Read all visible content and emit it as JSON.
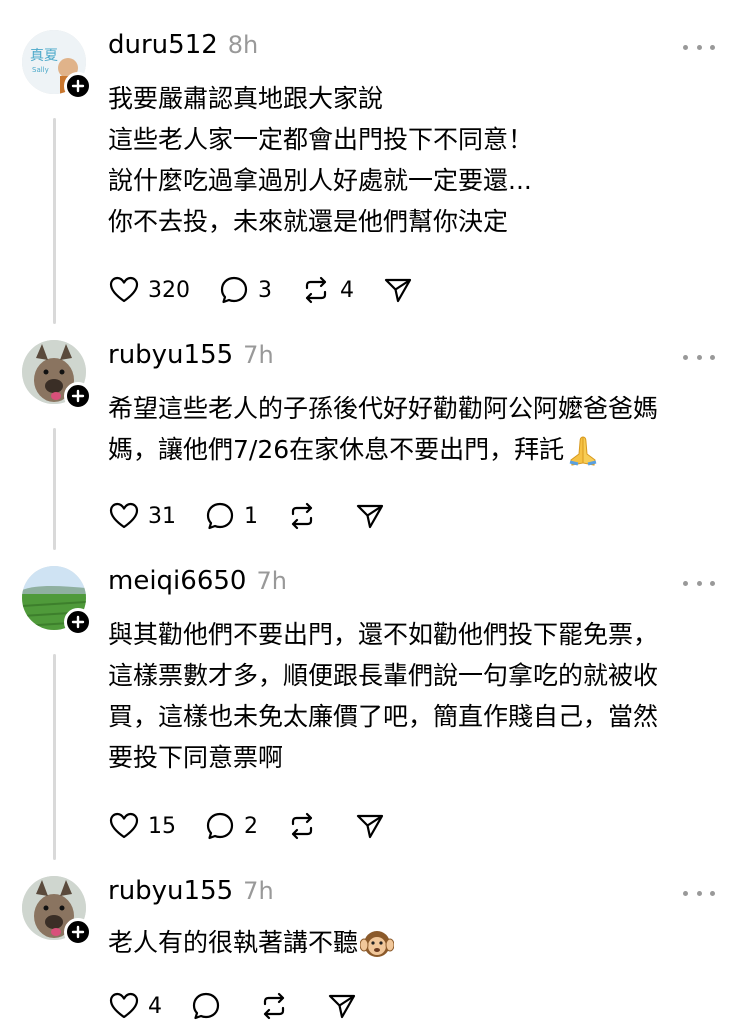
{
  "posts": [
    {
      "username": "duru512",
      "time": "8h",
      "avatar_text": "真夏",
      "avatar_subtext": "Sally",
      "lines": [
        "我要嚴肅認真地跟大家說",
        "這些老人家一定都會出門投下不同意！",
        "說什麼吃過拿過別人好處就一定要還...",
        "你不去投，未來就還是他們幫你決定"
      ],
      "likes": "320",
      "replies": "3",
      "reposts": "4"
    },
    {
      "username": "rubyu155",
      "time": "7h",
      "lines": [
        "希望這些老人的子孫後代好好勸勸阿公阿嬤爸爸媽",
        "媽，讓他們7/26在家休息不要出門，拜託"
      ],
      "emoji": "folded-hands",
      "likes": "31",
      "replies": "1",
      "reposts": ""
    },
    {
      "username": "meiqi6650",
      "time": "7h",
      "lines": [
        "與其勸他們不要出門，還不如勸他們投下罷免票，",
        "這樣票數才多，順便跟長輩們說一句拿吃的就被收",
        "買，這樣也未免太廉價了吧，簡直作賤自己，當然",
        "要投下同意票啊"
      ],
      "likes": "15",
      "replies": "2",
      "reposts": ""
    },
    {
      "username": "rubyu155",
      "time": "7h",
      "lines": [
        "老人有的很執著講不聽"
      ],
      "emoji": "hear-no-evil-monkey",
      "likes": "4",
      "replies": "",
      "reposts": ""
    }
  ],
  "colors": {
    "text": "#000000",
    "muted": "#999999",
    "line": "#d9d9d9"
  }
}
